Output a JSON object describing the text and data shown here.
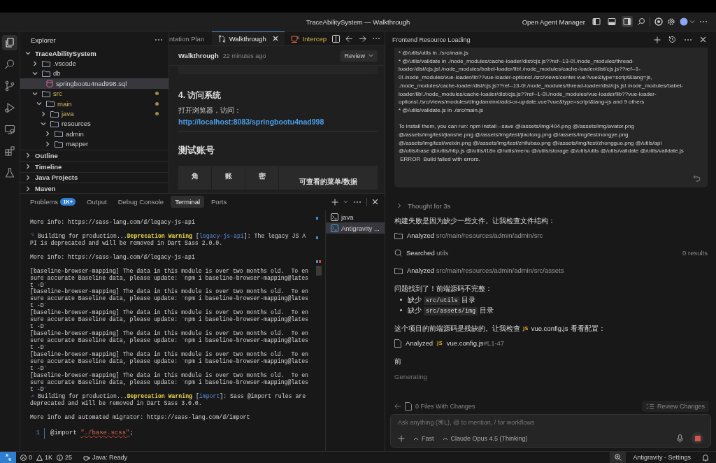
{
  "title_bar": {
    "title": "TraceAbilitySystem — Walkthrough",
    "agent_manager": "Open Agent Manager",
    "layout_toggles": [
      {
        "kind": "left",
        "selected": false
      },
      {
        "kind": "bottom",
        "selected": false
      },
      {
        "kind": "right",
        "selected": true
      }
    ]
  },
  "activity_bar": [
    {
      "kind": "files",
      "selected": true
    },
    {
      "kind": "search",
      "selected": false
    },
    {
      "kind": "source-control",
      "selected": false
    },
    {
      "kind": "run",
      "selected": false
    },
    {
      "kind": "remote",
      "selected": false
    },
    {
      "kind": "extensions",
      "selected": false
    },
    {
      "kind": "testing",
      "selected": false
    }
  ],
  "explorer": {
    "title": "Explorer",
    "tree": {
      "label": "TraceAbilitySystem",
      "expanded": true,
      "children": [
        {
          "label": ".vscode",
          "kind": "folder",
          "expanded": false,
          "selected": false,
          "modified": false
        },
        {
          "label": "db",
          "kind": "folder",
          "expanded": true,
          "selected": false,
          "modified": false,
          "children": [
            {
              "label": "springbootu4nad998.sql",
              "kind": "sql-file",
              "selected": true,
              "modified": false
            }
          ]
        },
        {
          "label": "src",
          "kind": "folder",
          "expanded": true,
          "selected": false,
          "modified": true,
          "children": [
            {
              "label": "main",
              "kind": "folder",
              "expanded": true,
              "selected": false,
              "modified": true,
              "children": [
                {
                  "label": "java",
                  "kind": "folder",
                  "expanded": false,
                  "selected": false,
                  "modified": true
                },
                {
                  "label": "resources",
                  "kind": "folder",
                  "expanded": true,
                  "selected": false,
                  "modified": false,
                  "children": [
                    {
                      "label": "admin",
                      "kind": "folder",
                      "expanded": false,
                      "selected": false,
                      "modified": false
                    },
                    {
                      "label": "mapper",
                      "kind": "folder",
                      "expanded": false,
                      "selected": false,
                      "modified": false
                    }
                  ]
                }
              ]
            }
          ]
        }
      ]
    },
    "sections": [
      {
        "label": "Outline",
        "expanded": false
      },
      {
        "label": "Timeline",
        "expanded": false
      },
      {
        "label": "Java Projects",
        "expanded": false
      },
      {
        "label": "Maven",
        "expanded": false
      }
    ]
  },
  "editor": {
    "tabs": [
      {
        "label": "ntation Plan",
        "kind": "plain",
        "selected": false
      },
      {
        "label": "Walkthrough",
        "kind": "walkthrough",
        "selected": true
      },
      {
        "label": "Intercep",
        "kind": "warning",
        "selected": false
      }
    ],
    "header": {
      "title": "Walkthrough",
      "time": "22 minutes ago",
      "button": "Review"
    },
    "heading": "4. 访问系统",
    "text": "打开浏览器，访问：",
    "link": "http://localhost:8083/springbootu4nad998",
    "heading_2": "测试账号",
    "table_header": [
      "角",
      "账",
      "密",
      "可查看的菜单/数据"
    ]
  },
  "panel": {
    "tabs": [
      {
        "label": "Problems",
        "badge": "1K+",
        "selected": false
      },
      {
        "label": "Output",
        "selected": false
      },
      {
        "label": "Debug Console",
        "selected": false
      },
      {
        "label": "Terminal",
        "selected": true
      },
      {
        "label": "Ports",
        "selected": false
      }
    ],
    "terminal": [
      [
        [
          {
            "text": "More info: https://sass-lang.com/d/legacy-js-api",
            "kind": "plain"
          }
        ]
      ],
      [
        [
          {
            "text": "⠙ ",
            "kind": "spinner"
          },
          {
            "text": "Building for production...",
            "kind": "plain"
          },
          {
            "text": "Deprecation Warning",
            "kind": "warning"
          },
          {
            "text": " [",
            "kind": "plain"
          },
          {
            "text": "legacy-js-api",
            "kind": "tag"
          },
          {
            "text": "]: The legacy JS API is deprecated and will be removed in Dart Sass 2.0.0.",
            "kind": "plain"
          }
        ]
      ],
      [
        [
          {
            "text": "More info: https://sass-lang.com/d/legacy-js-api",
            "kind": "plain"
          }
        ]
      ],
      [
        [
          {
            "text": "[baseline-browser-mapping] The data in this module is over two months old.  To ensure accurate Baseline data, please update: `npm i baseline-browser-mapping@latest -D`",
            "kind": "plain"
          }
        ],
        [
          {
            "text": "[baseline-browser-mapping] The data in this module is over two months old.  To ensure accurate Baseline data, please update: `npm i baseline-browser-mapping@latest -D`",
            "kind": "plain"
          }
        ],
        [
          {
            "text": "[baseline-browser-mapping] The data in this module is over two months old.  To ensure accurate Baseline data, please update: `npm i baseline-browser-mapping@latest -D`",
            "kind": "plain"
          }
        ],
        [
          {
            "text": "[baseline-browser-mapping] The data in this module is over two months old.  To ensure accurate Baseline data, please update: `npm i baseline-browser-mapping@latest -D`",
            "kind": "plain"
          }
        ],
        [
          {
            "text": "[baseline-browser-mapping] The data in this module is over two months old.  To ensure accurate Baseline data, please update: `npm i baseline-browser-mapping@latest -D`",
            "kind": "plain"
          }
        ],
        [
          {
            "text": "[baseline-browser-mapping] The data in this module is over two months old.  To ensure accurate Baseline data, please update: `npm i baseline-browser-mapping@latest -D`",
            "kind": "plain"
          }
        ],
        [
          {
            "text": "⠴ ",
            "kind": "spinner"
          },
          {
            "text": "Building for production...",
            "kind": "plain"
          },
          {
            "text": "Deprecation Warning",
            "kind": "warning"
          },
          {
            "text": " [",
            "kind": "plain"
          },
          {
            "text": "import",
            "kind": "tag"
          },
          {
            "text": "]: Sass @import rules are  deprecated and will be removed in Dart Sass 3.0.0.",
            "kind": "plain"
          }
        ]
      ],
      [
        [
          {
            "text": "More info and automated migrator: https://sass-lang.com/d/import",
            "kind": "plain"
          }
        ]
      ]
    ],
    "code_line": {
      "number": "1",
      "parts": [
        {
          "text": "@import ",
          "kind": "plain"
        },
        {
          "text": "\"./base.scss\"",
          "kind": "error-string"
        },
        {
          "text": ";",
          "kind": "plain"
        }
      ]
    },
    "terminals": [
      {
        "label": "java",
        "selected": false
      },
      {
        "label": "Antigravity ...",
        "selected": true
      }
    ]
  },
  "chat": {
    "title": "Frontend Resource Loading",
    "output": [
      "* @/utils/utils in ./src/main.js",
      "* @/utils/validate in ./node_modules/cache-loader/dist/cjs.js??ref--13-0!./node_modules/thread-loader/dist/cjs.js!./node_modules/babel-loader/lib!./node_modules/cache-loader/dist/cjs.js??ref--1-0!./node_modules/vue-loader/lib??vue-loader-options!./src/views/center.vue?vue&type=script&lang=js, ./node_modules/cache-loader/dist/cjs.js??ref--13-0!./node_modules/thread-loader/dist/cjs.js!./node_modules/babel-loader/lib!./node_modules/cache-loader/dist/cjs.js??ref--1-0!./node_modules/vue-loader/lib??vue-loader-options!./src/views/modules/dingdanxinxi/add-or-update.vue?vue&type=script&lang=js and 9 others",
      "* @/utils/validate.js in ./src/main.js",
      "To install them, you can run: npm install --save @/assets/img/404.png @/assets/img/avator.png @/assets/img/test/jianshe.png @/assets/img/test/jiaotong.png @/assets/img/test/nongye.png @/assets/img/test/weixin.png @/assets/img/test/zhifubao.png @/assets/img/test/zhongguo.png @/utils/api @/utils/base @/utils/http.js @/utils/i18n @/utils/menu @/utils/storage @/utils/utils @/utils/validate @/utils/validate.js",
      " ERROR  Build failed with errors."
    ],
    "thought": "Thought for 3s",
    "items": [
      {
        "kind": "text",
        "text": "构建失败是因为缺少一些文件。让我检查文件结构："
      },
      {
        "kind": "folder_step",
        "verb": "Analyzed",
        "target": "src/main/resources/admin/admin/src"
      },
      {
        "kind": "search_step",
        "verb": "Searched",
        "target": "utils",
        "result": "0 results"
      },
      {
        "kind": "folder_step",
        "verb": "Analyzed",
        "target": "src/main/resources/admin/admin/src/assets"
      },
      {
        "kind": "text",
        "text": "问题找到了！前端源码不完整："
      },
      {
        "kind": "bullets",
        "items": [
          {
            "before": "缺少",
            "code": "src/utils",
            "after": "目录"
          },
          {
            "before": "缺少",
            "code": "src/assets/img",
            "after": "目录"
          }
        ]
      },
      {
        "kind": "text_file",
        "before": "这个项目的前端源码是残缺的。让我检查",
        "badge": "JS",
        "file": "vue.config.js",
        "after": "看看配置："
      },
      {
        "kind": "tool_file",
        "verb": "Analyzed",
        "badge": "JS",
        "file": "vue.config.js",
        "range": "#L1-47"
      },
      {
        "kind": "text",
        "text": "前"
      },
      {
        "kind": "status",
        "text": "Generating"
      }
    ],
    "footer": {
      "files": "0 Files With Changes",
      "review": "Review Changes"
    },
    "input": {
      "placeholder": "Ask anything (⌘L), @ to mention, / for workflows",
      "mode": "Fast",
      "model": "Claude Opus 4.5 (Thinking)"
    }
  },
  "status_bar": {
    "errors": "0",
    "warnings": "1K",
    "infos": "25",
    "java": "Java: Ready",
    "settings": "Antigravity - Settings"
  }
}
